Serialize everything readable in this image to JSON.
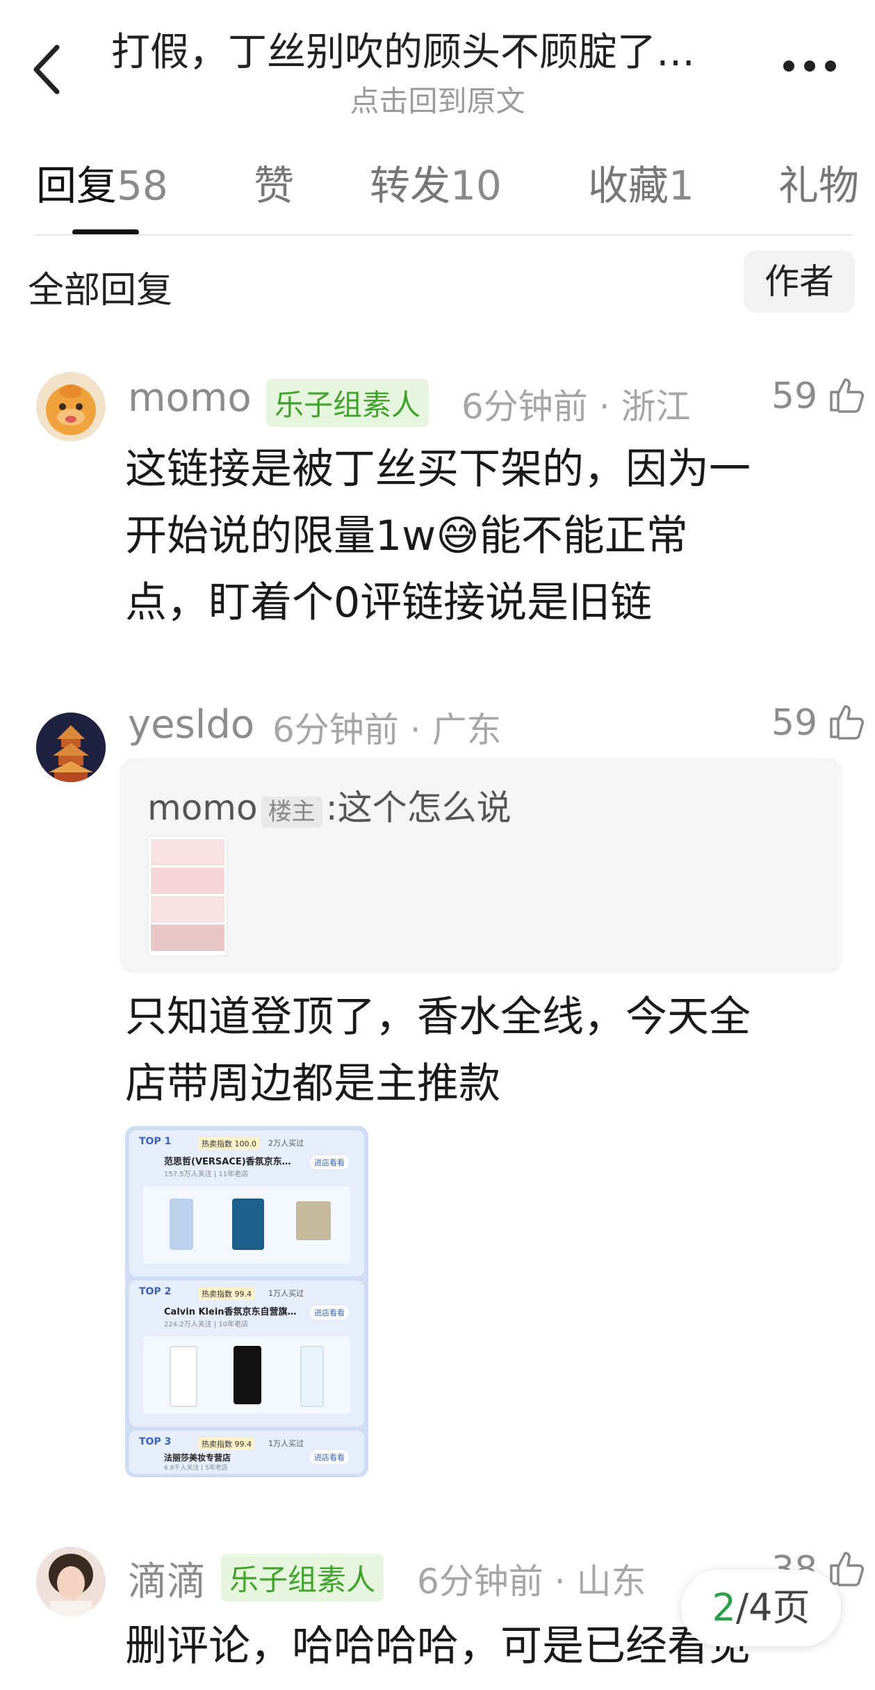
{
  "header": {
    "title": "打假，丁丝别吹的顾头不顾腚了…",
    "subtitle": "点击回到原文"
  },
  "tabs": [
    {
      "label": "回复",
      "count": "58"
    },
    {
      "label": "赞",
      "count": ""
    },
    {
      "label": "转发",
      "count": "10"
    },
    {
      "label": "收藏",
      "count": "1"
    },
    {
      "label": "礼物",
      "count": ""
    }
  ],
  "filter": {
    "all_label": "全部回复",
    "author_label": "作者"
  },
  "comments": [
    {
      "user": "momo",
      "badge": "乐子组素人",
      "time": "6分钟前",
      "location": "浙江",
      "likes": "59",
      "text_lines": [
        "这链接是被丁丝买下架的，因为一",
        "开始说的限量1w😅能不能正常",
        "点，盯着个0评链接说是旧链"
      ]
    },
    {
      "user": "yesldo",
      "time": "6分钟前",
      "location": "广东",
      "likes": "59",
      "quote": {
        "user": "momo",
        "owner_badge": "楼主",
        "text": ":这个怎么说"
      },
      "text_lines": [
        "只知道登顶了，香水全线，今天全",
        "店带周边都是主推款"
      ],
      "image": {
        "rows": [
          {
            "rank": "TOP 1",
            "hot": "热卖指数 100.0",
            "buyers": "2万人买过",
            "shop": "范思哲(VERSACE)香氛京东…",
            "followers": "157.5万人关注 | 11年老店",
            "enter": "进店看看"
          },
          {
            "rank": "TOP 2",
            "hot": "热卖指数 99.4",
            "buyers": "1万人买过",
            "shop": "Calvin Klein香氛京东自营旗…",
            "followers": "224.2万人关注 | 10年老店",
            "enter": "进店看看"
          },
          {
            "rank": "TOP 3",
            "hot": "热卖指数 99.4",
            "buyers": "1万人买过",
            "shop": "法丽莎美妆专营店",
            "followers": "6.8千人关注 | 5年老店",
            "enter": "进店看看"
          }
        ]
      }
    },
    {
      "user": "滴滴",
      "badge": "乐子组素人",
      "time": "6分钟前",
      "location": "山东",
      "likes": "38",
      "text_lines": [
        "删评论，哈哈哈哈，可是已经看见"
      ]
    }
  ],
  "pager": {
    "current": "2",
    "total": "/4页"
  },
  "colors": {
    "accent_green": "#42a32c",
    "page_green": "#2aa14a"
  }
}
